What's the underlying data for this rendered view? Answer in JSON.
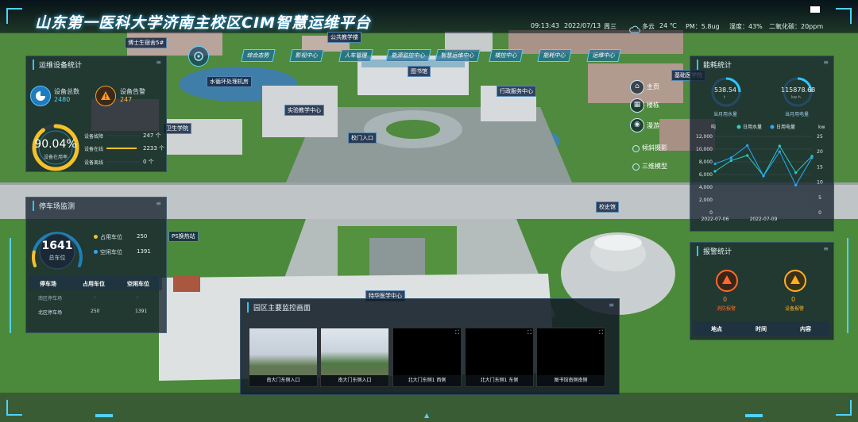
{
  "header": {
    "title": "山东第一医科大学济南主校区CIM智慧运维平台",
    "time": "09:13:43",
    "date": "2022/07/13",
    "weekday": "周三",
    "weather": "多云",
    "temperature": "24 ℃",
    "pm": "PM：5.8ug",
    "humidity": "湿度：43%",
    "co2": "二氧化碳：20ppm"
  },
  "nav_tabs": [
    "综合态势",
    "影视中心",
    "人车管理",
    "能源监控中心",
    "智慧运维中心",
    "楼控中心",
    "能耗中心",
    "运维中心"
  ],
  "side_menu": [
    "主页",
    "楼栋",
    "漫游",
    "倾斜摄影",
    "三维模型"
  ],
  "map_labels": {
    "doctor_dorm": "博士生宿舍5#",
    "public_building": "公共教学楼",
    "library": "图书馆",
    "water_plant": "水循环处理机房",
    "experiment_center": "实验教学中心",
    "admin_center": "行政服务中心",
    "health_school": "卫生学院",
    "gate": "校门入口",
    "museum": "校史馆",
    "ps_station": "PS换热站",
    "special_medical": "特华医学中心",
    "basic_medical": "基础医学院"
  },
  "ops": {
    "title": "运维设备统计",
    "device_total_label": "设备总数",
    "device_total": "2480",
    "device_alarm_label": "设备告警",
    "device_alarm": "247",
    "percent": "90.04%",
    "percent_label": "设备在用率",
    "rows": [
      {
        "label": "设备故障",
        "value": "247 个"
      },
      {
        "label": "设备在线",
        "value": "2233 个"
      },
      {
        "label": "设备离线",
        "value": "0 个"
      }
    ],
    "online_fraction": 0.9004
  },
  "parking": {
    "title": "停车场监测",
    "total": "1641",
    "total_label": "总车位",
    "used_label": "占用车位",
    "used": "250",
    "free_label": "空闲车位",
    "free": "1391",
    "used_fraction": 0.152,
    "table_headers": [
      "停车场",
      "占用车位",
      "空闲车位"
    ],
    "table_rows": [
      [
        "南区停车场",
        "-",
        "-"
      ],
      [
        "北区停车场",
        "250",
        "1391"
      ]
    ]
  },
  "energy": {
    "title": "能耗统计",
    "water_value": "538.54",
    "water_unit": "t",
    "water_label": "当月用水量",
    "power_value": "115878.68",
    "power_unit": "kw·h",
    "power_label": "当月用电量"
  },
  "chart_data": {
    "type": "line",
    "title": "",
    "ylabel_left": "吨",
    "ylabel_right": "kw",
    "x": [
      "2022-07-06",
      "2022-07-07",
      "2022-07-08",
      "2022-07-09",
      "2022-07-10",
      "2022-07-11",
      "2022-07-12"
    ],
    "x_tick_labels": [
      "2022-07-06",
      "2022-07-09"
    ],
    "ylim_left": [
      0,
      12000
    ],
    "yticks_left": [
      0,
      2000,
      4000,
      6000,
      8000,
      10000,
      12000
    ],
    "ylim_right": [
      0,
      25
    ],
    "yticks_right": [
      0,
      5,
      10,
      15,
      20,
      25
    ],
    "legend_position": "top",
    "series": [
      {
        "name": "日用水量",
        "axis": "left",
        "color": "#27d0c4",
        "values": [
          6500,
          8200,
          9000,
          5800,
          10500,
          6300,
          8900
        ]
      },
      {
        "name": "日用电量",
        "axis": "right",
        "color": "#2aa8ff",
        "values": [
          16,
          18,
          22,
          12,
          20,
          9,
          18
        ]
      }
    ]
  },
  "alarm": {
    "title": "报警统计",
    "items": [
      {
        "value": "0",
        "label": "消防报警",
        "color": "#ff6a2a"
      },
      {
        "value": "0",
        "label": "设备报警",
        "color": "#ffb020"
      }
    ],
    "table_headers": [
      "地点",
      "时间",
      "内容"
    ]
  },
  "monitor": {
    "title": "园区主要监控画面",
    "cameras": [
      "南大门东侧入口",
      "南大门东侧入口",
      "北大门东侧1 西侧",
      "北大门东侧1 东侧",
      "图书馆南侧南侧"
    ]
  }
}
